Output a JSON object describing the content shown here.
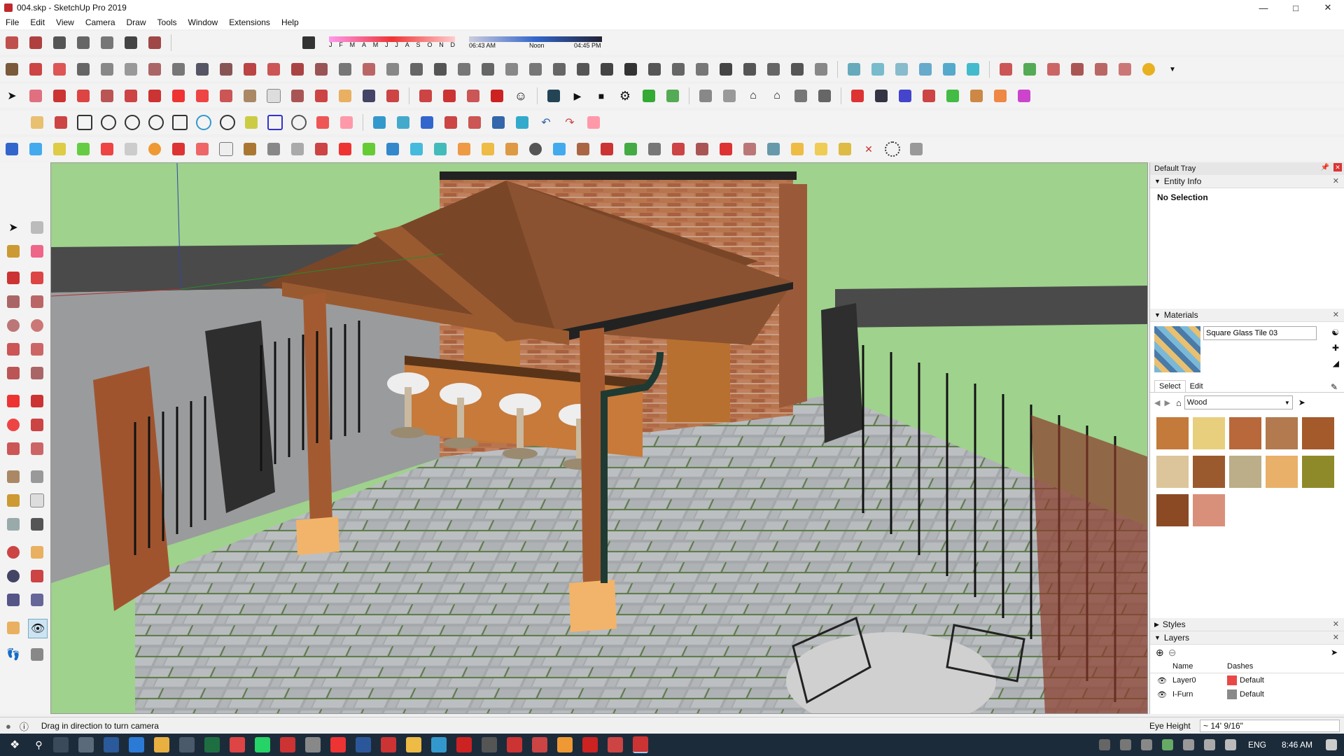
{
  "window": {
    "title": "004.skp - SketchUp Pro 2019"
  },
  "menu": [
    "File",
    "Edit",
    "View",
    "Camera",
    "Draw",
    "Tools",
    "Window",
    "Extensions",
    "Help"
  ],
  "shadows": {
    "months": [
      "J",
      "F",
      "M",
      "A",
      "M",
      "J",
      "J",
      "A",
      "S",
      "O",
      "N",
      "D"
    ],
    "time_start": "06:43 AM",
    "time_mid": "Noon",
    "time_end": "04:45 PM"
  },
  "tray": {
    "title": "Default Tray",
    "entity_info": {
      "header": "Entity Info",
      "selection": "No Selection"
    },
    "materials": {
      "header": "Materials",
      "material_name": "Square Glass Tile 03",
      "tab_select": "Select",
      "tab_edit": "Edit",
      "library": "Wood",
      "swatch_colors": [
        "#c47a3a",
        "#e8cf7e",
        "#b8683a",
        "#b27a4e",
        "#a45a2a",
        "#dcc59a",
        "#9b5a2e",
        "#bbae88",
        "#e8b068",
        "#8e8a2a",
        "#8c4a24",
        "#d9907a"
      ]
    },
    "styles": {
      "header": "Styles"
    },
    "layers": {
      "header": "Layers",
      "col_name": "Name",
      "col_dashes": "Dashes",
      "rows": [
        {
          "name": "Layer0",
          "color": "#e84848",
          "dashes": "Default"
        },
        {
          "name": "I-Furn",
          "color": "#8a8a8a",
          "dashes": "Default"
        }
      ]
    }
  },
  "status": {
    "message": "Drag in direction to turn camera",
    "measure_label": "Eye Height",
    "measure_value": "~ 14' 9/16\""
  },
  "taskbar": {
    "lang": "ENG",
    "time": "8:46 AM"
  }
}
